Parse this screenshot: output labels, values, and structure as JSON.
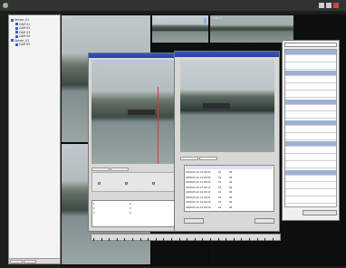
{
  "app": {
    "title": "",
    "accent": "#3054c0"
  },
  "sidebar": {
    "items": [
      {
        "label": "Server_01",
        "indent": 0
      },
      {
        "label": "CAM 01",
        "indent": 1
      },
      {
        "label": "CAM 02",
        "indent": 1
      },
      {
        "label": "CAM 03",
        "indent": 1
      },
      {
        "label": "CAM 04",
        "indent": 1
      },
      {
        "label": "Server_02",
        "indent": 0
      },
      {
        "label": "CAM 05",
        "indent": 1
      }
    ],
    "bottom_tabs": [
      "",
      ""
    ]
  },
  "main": {
    "tiles": [
      {
        "label": "CAM 01"
      },
      {
        "label": "CAM 02"
      },
      {
        "label": "CAM 03"
      },
      {
        "label": "CAM 04"
      }
    ]
  },
  "dialog_back": {
    "title": "",
    "preview_label": "",
    "tabs": [
      "",
      ""
    ],
    "rows": [
      {
        "c1": "1",
        "c2": "",
        "c3": "0",
        "c4": ""
      },
      {
        "c1": "2",
        "c2": "",
        "c3": "0",
        "c4": ""
      },
      {
        "c1": "3",
        "c2": "",
        "c3": "0",
        "c4": ""
      }
    ]
  },
  "dialog_front": {
    "title": "",
    "tabs": [
      "",
      ""
    ],
    "table_headers": [
      "",
      "",
      "",
      ""
    ],
    "rows": [
      {
        "time": "2008-05-01 12:00:01",
        "ch": "01",
        "val": "00",
        "desc": ""
      },
      {
        "time": "2008-05-01 12:00:05",
        "ch": "01",
        "val": "00",
        "desc": ""
      },
      {
        "time": "2008-05-01 12:00:09",
        "ch": "01",
        "val": "00",
        "desc": ""
      },
      {
        "time": "2008-05-01 12:00:13",
        "ch": "01",
        "val": "00",
        "desc": ""
      },
      {
        "time": "2008-05-01 12:00:17",
        "ch": "01",
        "val": "00",
        "desc": ""
      },
      {
        "time": "2008-05-01 12:00:21",
        "ch": "01",
        "val": "00",
        "desc": ""
      },
      {
        "time": "2008-05-01 12:00:25",
        "ch": "01",
        "val": "00",
        "desc": ""
      },
      {
        "time": "2008-05-01 12:00:29",
        "ch": "01",
        "val": "00",
        "desc": ""
      }
    ],
    "button_left": "",
    "button_right": ""
  },
  "properties": {
    "selector": "",
    "rows": [
      {
        "k": "",
        "v": "",
        "hd": true
      },
      {
        "k": "",
        "v": ""
      },
      {
        "k": "",
        "v": ""
      },
      {
        "k": "",
        "v": "",
        "hd": true
      },
      {
        "k": "",
        "v": ""
      },
      {
        "k": "",
        "v": ""
      },
      {
        "k": "",
        "v": ""
      },
      {
        "k": "",
        "v": "",
        "hd": true
      },
      {
        "k": "",
        "v": ""
      },
      {
        "k": "",
        "v": ""
      },
      {
        "k": "",
        "v": "",
        "hd": true
      },
      {
        "k": "",
        "v": ""
      },
      {
        "k": "",
        "v": ""
      },
      {
        "k": "",
        "v": "",
        "hd": true
      },
      {
        "k": "",
        "v": ""
      },
      {
        "k": "",
        "v": ""
      },
      {
        "k": "",
        "v": ""
      },
      {
        "k": "",
        "v": "",
        "hd": true
      },
      {
        "k": "",
        "v": ""
      },
      {
        "k": "",
        "v": ""
      },
      {
        "k": "",
        "v": ""
      },
      {
        "k": "",
        "v": ""
      }
    ],
    "footer_button": ""
  }
}
